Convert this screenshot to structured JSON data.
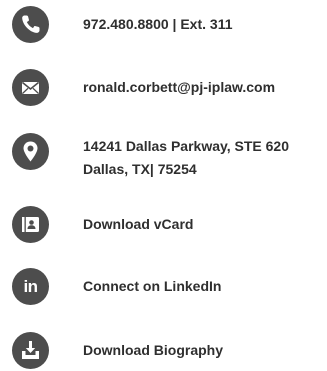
{
  "contact": {
    "phone": {
      "label": "972.480.8800 | Ext. 311",
      "icon": "phone-icon"
    },
    "email": {
      "label": "ronald.corbett@pj-iplaw.com",
      "icon": "envelope-icon"
    },
    "address": {
      "line1": "14241 Dallas Parkway, STE 620",
      "line2": "Dallas, TX| 75254",
      "icon": "location-pin-icon"
    },
    "vcard": {
      "label": "Download vCard",
      "icon": "contact-card-icon"
    },
    "linkedin": {
      "label": "Connect on LinkedIn",
      "icon_text": "in",
      "icon": "linkedin-icon"
    },
    "biography": {
      "label": "Download Biography",
      "icon": "download-tray-icon"
    }
  },
  "colors": {
    "icon_background": "#4d4d4d",
    "icon_foreground": "#ffffff",
    "text": "#2f2f2f"
  }
}
